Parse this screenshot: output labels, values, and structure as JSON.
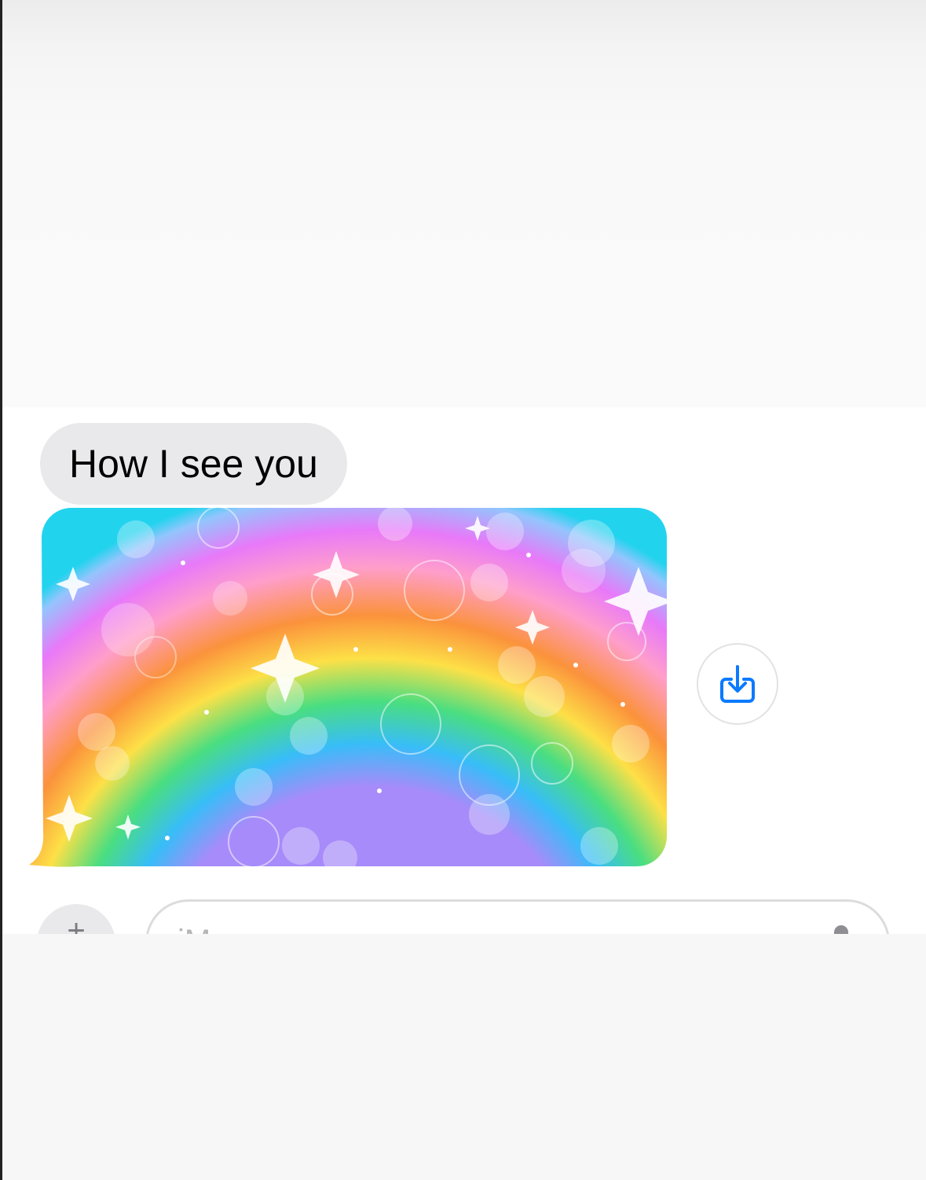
{
  "conversation": {
    "messages": [
      {
        "type": "text",
        "text": "How I see you"
      },
      {
        "type": "image",
        "alt": ""
      }
    ],
    "download_icon": "save-to-photos-icon"
  },
  "composer": {
    "placeholder": "iMessage",
    "plus_glyph": "+",
    "mic_icon": "microphone-icon"
  },
  "colors": {
    "incoming_bubble": "#e9e9eb",
    "accent": "#0a7aff"
  }
}
